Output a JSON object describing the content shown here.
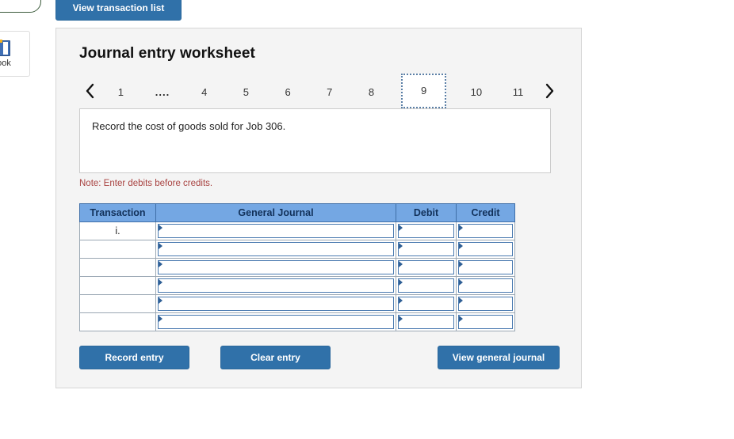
{
  "left_chrome": {
    "card_label": "ook",
    "card_icon": "book-icon"
  },
  "toolbar": {
    "view_transaction_list_label": "View transaction list"
  },
  "panel": {
    "title": "Journal entry worksheet",
    "nav": {
      "prev_icon": "chevron-left-icon",
      "next_icon": "chevron-right-icon",
      "tabs": [
        {
          "label": "1",
          "active": false
        },
        {
          "label": "....",
          "active": false
        },
        {
          "label": "4",
          "active": false
        },
        {
          "label": "5",
          "active": false
        },
        {
          "label": "6",
          "active": false
        },
        {
          "label": "7",
          "active": false
        },
        {
          "label": "8",
          "active": false
        },
        {
          "label": "9",
          "active": true
        },
        {
          "label": "10",
          "active": false
        },
        {
          "label": "11",
          "active": false
        }
      ]
    },
    "instruction": "Record the cost of goods sold for Job 306.",
    "note": "Note: Enter debits before credits.",
    "table": {
      "headers": [
        "Transaction",
        "General Journal",
        "Debit",
        "Credit"
      ],
      "rows": [
        {
          "transaction": "i.",
          "journal": "",
          "debit": "",
          "credit": ""
        },
        {
          "transaction": "",
          "journal": "",
          "debit": "",
          "credit": ""
        },
        {
          "transaction": "",
          "journal": "",
          "debit": "",
          "credit": ""
        },
        {
          "transaction": "",
          "journal": "",
          "debit": "",
          "credit": ""
        },
        {
          "transaction": "",
          "journal": "",
          "debit": "",
          "credit": ""
        },
        {
          "transaction": "",
          "journal": "",
          "debit": "",
          "credit": ""
        }
      ]
    },
    "buttons": {
      "record_entry": "Record entry",
      "clear_entry": "Clear entry",
      "view_general_journal": "View general journal"
    }
  },
  "colors": {
    "button_blue": "#3071a9",
    "table_header_blue": "#74a7e3",
    "note_red": "#a94442",
    "panel_bg": "#f4f4f4"
  }
}
